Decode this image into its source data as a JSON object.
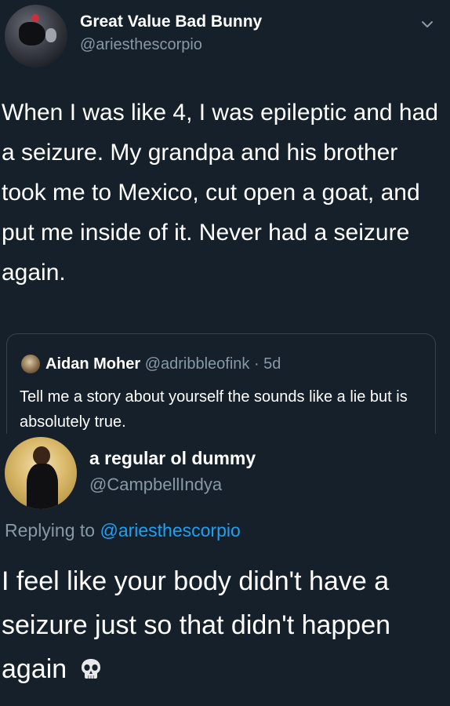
{
  "tweet": {
    "display_name": "Great Value Bad Bunny",
    "handle": "@ariesthescorpio",
    "text": "When I was like 4, I was epileptic and had a seizure. My grandpa and his brother took me to Mexico, cut open a goat, and put me inside of it. Never had a seizure again.",
    "menu_icon": "chevron-down-icon",
    "quoted": {
      "display_name": "Aidan Moher",
      "handle_time": "@adribbleofink · 5d",
      "text": "Tell me a story about yourself the sounds like a lie but is absolutely true."
    }
  },
  "reply": {
    "display_name": "a regular ol dummy",
    "handle": "@CampbellIndya",
    "replying_prefix": "Replying to ",
    "replying_mention": "@ariesthescorpio",
    "text": "I feel like your body didn't have a seizure just so that didn't happen again",
    "emoji_icon": "skull-icon"
  },
  "colors": {
    "background": "#15202b",
    "secondary_text": "#8899a6",
    "link": "#1da1f2",
    "border": "#38444d"
  }
}
